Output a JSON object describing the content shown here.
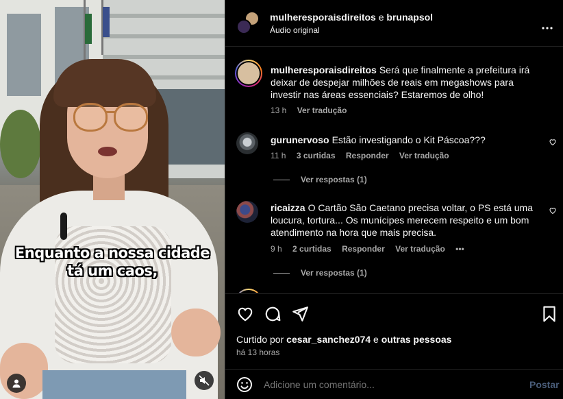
{
  "video": {
    "caption_line1": "Enquanto a nossa cidade",
    "caption_line2": "tá um caos,"
  },
  "header": {
    "user1": "mulheresporaisdireitos",
    "separator": "e",
    "user2": "brunapsol",
    "audio": "Áudio original",
    "more_icon": "more-horizontal-icon"
  },
  "comments": [
    {
      "user": "mulheresporaisdireitos",
      "text": "Será que finalmente a prefeitura irá deixar de despejar milhões de reais em megashows para investir nas áreas essenciais? Estaremos de olho!",
      "time": "13 h",
      "translate": "Ver tradução"
    },
    {
      "user": "gurunervoso",
      "text": "Estão investigando o Kit Páscoa???",
      "time": "11 h",
      "likes": "3 curtidas",
      "reply": "Responder",
      "translate": "Ver tradução",
      "replies": "Ver respostas (1)"
    },
    {
      "user": "ricaizza",
      "text": "O Cartão São Caetano precisa voltar, o PS está uma loucura, tortura... Os munícipes merecem respeito e um bom atendimento na hora que mais precisa.",
      "time": "9 h",
      "likes": "2 curtidas",
      "reply": "Responder",
      "translate": "Ver tradução",
      "more": "•••",
      "replies": "Ver respostas (1)"
    }
  ],
  "actions": {
    "liked_prefix": "Curtido por",
    "liked_user": "cesar_sanchez074",
    "liked_and": "e",
    "liked_others": "outras pessoas",
    "timestamp": "há 13 horas"
  },
  "add_comment": {
    "placeholder": "Adicione um comentário...",
    "post": "Postar"
  },
  "colors": {
    "background": "#000000",
    "text": "#f5f5f5",
    "muted": "#a8a8a8",
    "post_disabled": "#4a5d7a"
  }
}
